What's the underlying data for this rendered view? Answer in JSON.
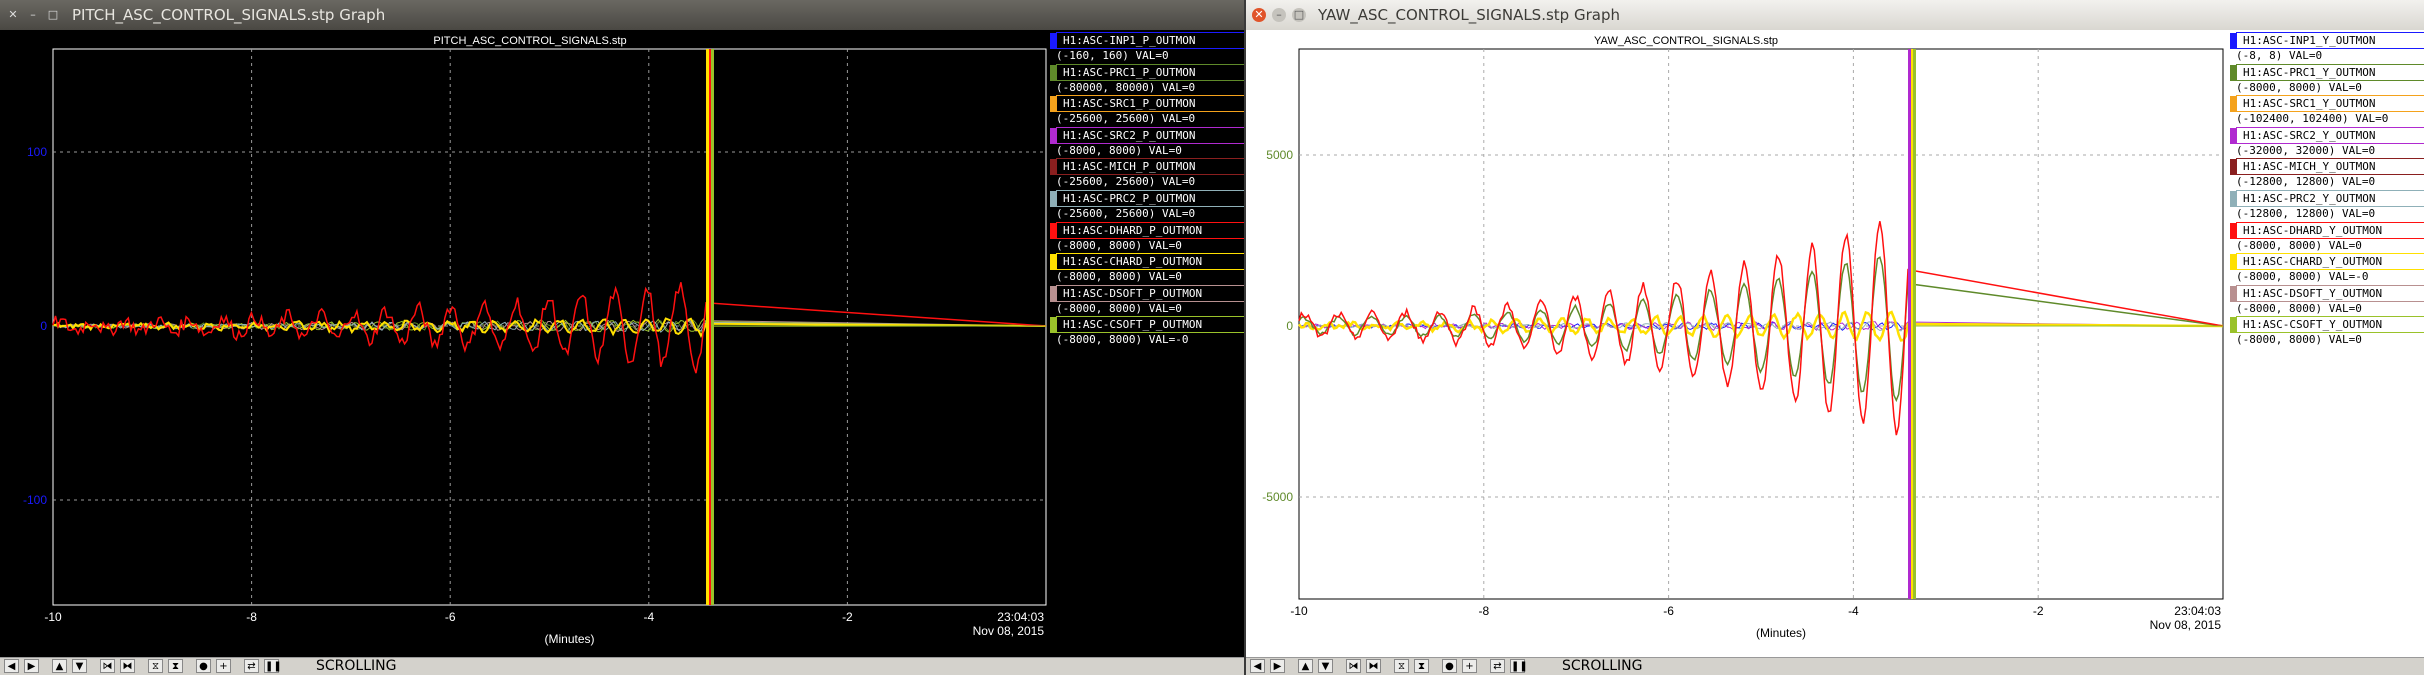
{
  "left": {
    "window_title": "PITCH_ASC_CONTROL_SIGNALS.stp Graph",
    "plot_title": "PITCH_ASC_CONTROL_SIGNALS.stp",
    "x_ticks": [
      "-10",
      "-8",
      "-6",
      "-4",
      "-2"
    ],
    "y_ticks": [
      "100",
      "0",
      "-100"
    ],
    "xlabel": "(Minutes)",
    "end_time": "23:04:03",
    "end_date": "Nov 08, 2015",
    "legend": [
      {
        "name": "H1:ASC-INP1_P_OUTMON",
        "range": "(-160, 160) VAL=0",
        "color": "#1a1aff"
      },
      {
        "name": "H1:ASC-PRC1_P_OUTMON",
        "range": "(-80000, 80000) VAL=0",
        "color": "#5f8a2a"
      },
      {
        "name": "H1:ASC-SRC1_P_OUTMON",
        "range": "(-25600, 25600) VAL=0",
        "color": "#f4a21c"
      },
      {
        "name": "H1:ASC-SRC2_P_OUTMON",
        "range": "(-8000, 8000) VAL=0",
        "color": "#b02ad0"
      },
      {
        "name": "H1:ASC-MICH_P_OUTMON",
        "range": "(-25600, 25600) VAL=0",
        "color": "#8a1f1f"
      },
      {
        "name": "H1:ASC-PRC2_P_OUTMON",
        "range": "(-25600, 25600) VAL=0",
        "color": "#8fb0b8"
      },
      {
        "name": "H1:ASC-DHARD_P_OUTMON",
        "range": "(-8000, 8000) VAL=0",
        "color": "#ff1010"
      },
      {
        "name": "H1:ASC-CHARD_P_OUTMON",
        "range": "(-8000, 8000) VAL=0",
        "color": "#ffe000"
      },
      {
        "name": "H1:ASC-DSOFT_P_OUTMON",
        "range": "(-8000, 8000) VAL=0",
        "color": "#b89090"
      },
      {
        "name": "H1:ASC-CSOFT_P_OUTMON",
        "range": "(-8000, 8000) VAL=-0",
        "color": "#9ac22a"
      }
    ],
    "scrolling_label": "SCROLLING"
  },
  "right": {
    "window_title": "YAW_ASC_CONTROL_SIGNALS.stp Graph",
    "plot_title": "YAW_ASC_CONTROL_SIGNALS.stp",
    "x_ticks": [
      "-10",
      "-8",
      "-6",
      "-4",
      "-2"
    ],
    "y_ticks": [
      "5000",
      "0",
      "-5000"
    ],
    "xlabel": "(Minutes)",
    "end_time": "23:04:03",
    "end_date": "Nov 08, 2015",
    "legend": [
      {
        "name": "H1:ASC-INP1_Y_OUTMON",
        "range": "(-8, 8) VAL=0",
        "color": "#1a1aff"
      },
      {
        "name": "H1:ASC-PRC1_Y_OUTMON",
        "range": "(-8000, 8000) VAL=0",
        "color": "#5f8a2a"
      },
      {
        "name": "H1:ASC-SRC1_Y_OUTMON",
        "range": "(-102400, 102400) VAL=0",
        "color": "#f4a21c"
      },
      {
        "name": "H1:ASC-SRC2_Y_OUTMON",
        "range": "(-32000, 32000) VAL=0",
        "color": "#b02ad0"
      },
      {
        "name": "H1:ASC-MICH_Y_OUTMON",
        "range": "(-12800, 12800) VAL=0",
        "color": "#8a1f1f"
      },
      {
        "name": "H1:ASC-PRC2_Y_OUTMON",
        "range": "(-12800, 12800) VAL=0",
        "color": "#8fb0b8"
      },
      {
        "name": "H1:ASC-DHARD_Y_OUTMON",
        "range": "(-8000, 8000) VAL=0",
        "color": "#ff1010"
      },
      {
        "name": "H1:ASC-CHARD_Y_OUTMON",
        "range": "(-8000, 8000) VAL=-0",
        "color": "#ffe000"
      },
      {
        "name": "H1:ASC-DSOFT_Y_OUTMON",
        "range": "(-8000, 8000) VAL=0",
        "color": "#b89090"
      },
      {
        "name": "H1:ASC-CSOFT_Y_OUTMON",
        "range": "(-8000, 8000) VAL=0",
        "color": "#9ac22a"
      }
    ],
    "scrolling_label": "SCROLLING"
  },
  "toolbar_icons": [
    "arrow-left-icon",
    "arrow-right-icon",
    "arrow-up-icon",
    "arrow-down-icon",
    "shrink-horizontal-icon",
    "expand-horizontal-icon",
    "shrink-vertical-icon",
    "expand-vertical-icon",
    "record-icon",
    "plus-icon",
    "scroll-toggle-icon",
    "pause-icon"
  ],
  "colors": {
    "left_bg": "#000000",
    "right_bg": "#ffffff",
    "grid": "#888888",
    "left_ytick": "#1a1aff",
    "right_ytick": "#5f8a2a"
  }
}
